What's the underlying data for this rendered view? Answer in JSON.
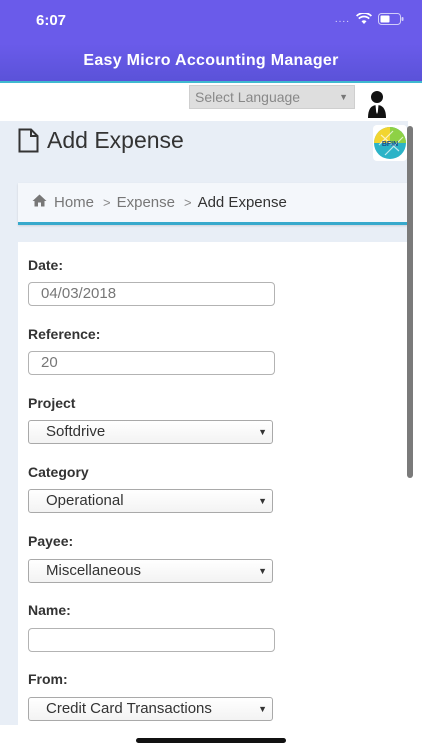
{
  "status_bar": {
    "time": "6:07",
    "dots": "....",
    "wifi_icon": "wifi-icon",
    "battery_icon": "battery-icon"
  },
  "header": {
    "title": "Easy Micro Accounting Manager",
    "bg_color": "#6a5bea",
    "accent_line": "#3fb9d0"
  },
  "language": {
    "label": "Select Language",
    "user_icon": "user-icon"
  },
  "page": {
    "title": "Add Expense",
    "title_icon": "document-icon",
    "logo_text": "BFIN"
  },
  "breadcrumb": {
    "home": "Home",
    "section": "Expense",
    "current": "Add Expense"
  },
  "form": {
    "date": {
      "label": "Date:",
      "value": "04/03/2018"
    },
    "reference": {
      "label": "Reference:",
      "value": "20"
    },
    "project": {
      "label": "Project",
      "value": "Softdrive"
    },
    "category": {
      "label": "Category",
      "value": "Operational"
    },
    "payee": {
      "label": "Payee:",
      "value": "Miscellaneous"
    },
    "name": {
      "label": "Name:",
      "value": ""
    },
    "from": {
      "label": "From:",
      "value": "Credit Card Transactions"
    }
  }
}
